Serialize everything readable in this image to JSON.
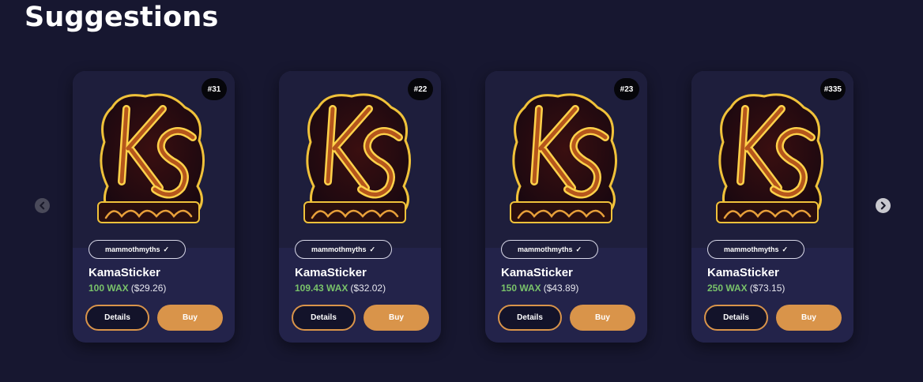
{
  "page": {
    "title": "Suggestions"
  },
  "colors": {
    "background": "#171730",
    "card": "#23234a",
    "accent": "#d9944a",
    "wax": "#79c26a"
  },
  "nav": {
    "prev_icon": "chevron-left-icon",
    "next_icon": "chevron-right-icon"
  },
  "cards": [
    {
      "badge": "#31",
      "creator": "mammothmyths",
      "verified_icon": "check-icon",
      "name": "KamaSticker",
      "wax": "100 WAX",
      "usd": "($29.26)",
      "details_label": "Details",
      "buy_label": "Buy"
    },
    {
      "badge": "#22",
      "creator": "mammothmyths",
      "verified_icon": "check-icon",
      "name": "KamaSticker",
      "wax": "109.43 WAX",
      "usd": "($32.02)",
      "details_label": "Details",
      "buy_label": "Buy"
    },
    {
      "badge": "#23",
      "creator": "mammothmyths",
      "verified_icon": "check-icon",
      "name": "KamaSticker",
      "wax": "150 WAX",
      "usd": "($43.89)",
      "details_label": "Details",
      "buy_label": "Buy"
    },
    {
      "badge": "#335",
      "creator": "mammothmyths",
      "verified_icon": "check-icon",
      "name": "KamaSticker",
      "wax": "250 WAX",
      "usd": "($73.15)",
      "details_label": "Details",
      "buy_label": "Buy"
    }
  ]
}
